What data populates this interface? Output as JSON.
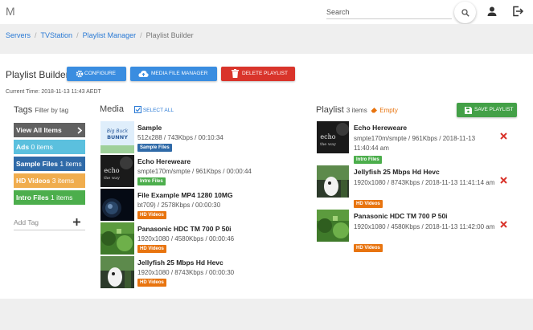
{
  "topbar": {
    "logo": "M",
    "search_placeholder": "Search"
  },
  "breadcrumb": [
    "Servers",
    "TVStation",
    "Playlist Manager",
    "Playlist Builder"
  ],
  "page": {
    "title": "Playlist Builder",
    "configure_label": "CONFIGURE",
    "media_manager_label": "MEDIA FILE MANAGER",
    "delete_label": "DELETE PLAYLIST",
    "current_time": "Current Time: 2018-11-13 11:43 AEDT"
  },
  "tags": {
    "title": "Tags",
    "subtitle": "Filter by tag",
    "items": [
      {
        "name": "View All Items",
        "count": "",
        "color": "#616161"
      },
      {
        "name": "Ads",
        "count": "0 items",
        "color": "#5bc0de"
      },
      {
        "name": "Sample Files",
        "count": "1 items",
        "color": "#2f6aa8"
      },
      {
        "name": "HD Videos",
        "count": "3 items",
        "color": "#f0ad4e"
      },
      {
        "name": "Intro Files",
        "count": "1 items",
        "color": "#4cae4c"
      }
    ],
    "add_placeholder": "Add Tag"
  },
  "media": {
    "title": "Media",
    "select_all": "SELECT ALL",
    "items": [
      {
        "title": "Sample",
        "sub": "512x288 / 743Kbps / 00:10:34",
        "badge": "Sample Files",
        "badge_color": "#2f6aa8"
      },
      {
        "title": "Echo Hereweare",
        "sub": "smpte170m/smpte / 961Kbps / 00:00:44",
        "badge": "Intro Files",
        "badge_color": "#4cae4c"
      },
      {
        "title": "File Example MP4 1280 10MG",
        "sub": "bt709) / 2578Kbps / 00:00:30",
        "badge": "HD Videos",
        "badge_color": "#e8740f"
      },
      {
        "title": "Panasonic HDC TM 700 P 50i",
        "sub": "1920x1080 / 4580Kbps / 00:00:46",
        "badge": "HD Videos",
        "badge_color": "#e8740f"
      },
      {
        "title": "Jellyfish 25 Mbps Hd Hevc",
        "sub": "1920x1080 / 8743Kbps / 00:00:30",
        "badge": "HD Videos",
        "badge_color": "#e8740f"
      }
    ]
  },
  "playlist": {
    "title": "Playlist",
    "count": "3 items",
    "empty_label": "Empty",
    "save_label": "SAVE PLAYLIST",
    "items": [
      {
        "title": "Echo Hereweare",
        "sub": "smpte170m/smpte / 961Kbps / 2018-11-13 11:40:44 am",
        "badge": "Intro Files",
        "badge_color": "#4cae4c"
      },
      {
        "title": "Jellyfish 25 Mbps Hd Hevc",
        "sub": "1920x1080 / 8743Kbps / 2018-11-13 11:41:14 am",
        "badge": "HD Videos",
        "badge_color": "#e8740f"
      },
      {
        "title": "Panasonic HDC TM 700 P 50i",
        "sub": "1920x1080 / 4580Kbps / 2018-11-13 11:42:00 am",
        "badge": "HD Videos",
        "badge_color": "#e8740f"
      }
    ]
  },
  "thumbs": {
    "sample_text_1": "Big Buck",
    "sample_text_2": "BUNNY",
    "echo_text_1": "echo",
    "echo_text_2": "the way"
  },
  "colors": {
    "primary": "#3a8de0",
    "danger": "#d9342b",
    "success": "#43a047",
    "link": "#2a7ad5",
    "delete_x": "#d9342b"
  }
}
